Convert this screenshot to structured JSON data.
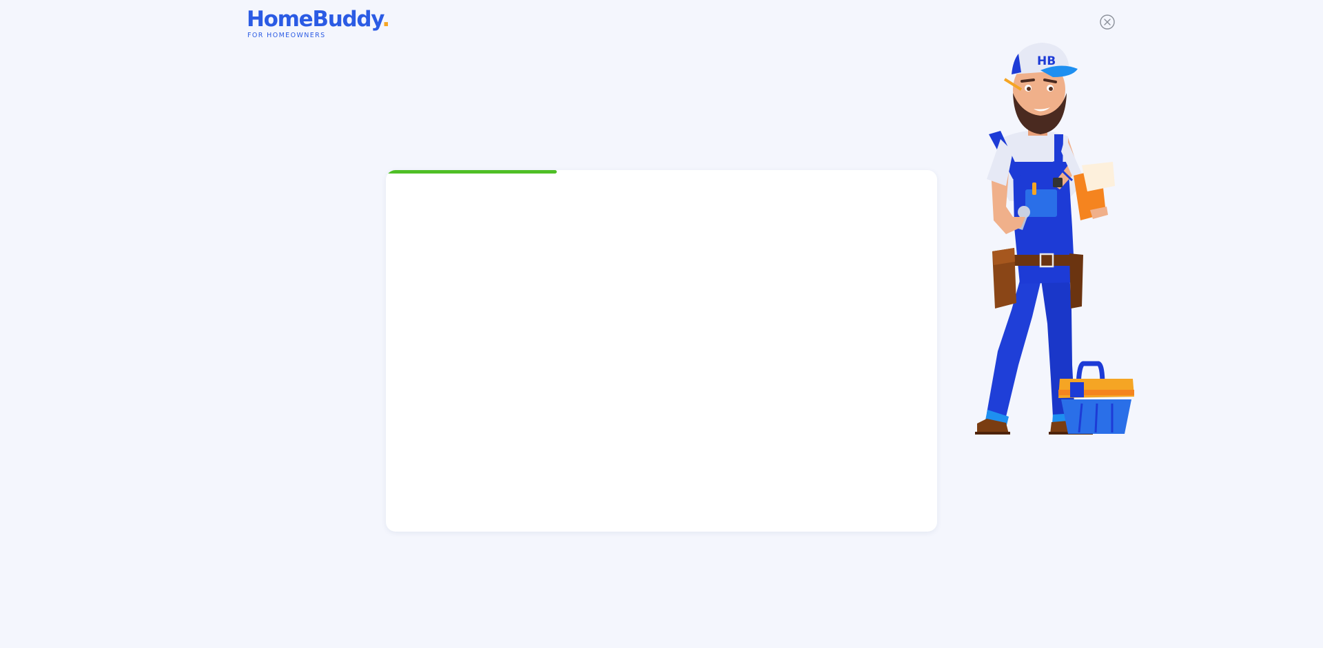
{
  "brand": {
    "name": "HomeBuddy",
    "dot": ".",
    "tagline": "FOR HOMEOWNERS",
    "primary_color": "#2b5be4",
    "accent_color": "#f5a524"
  },
  "header": {
    "close_icon": "close-circle-icon"
  },
  "form": {
    "progress_fraction": 0.31,
    "progress_color": "#4fbf26"
  },
  "illustration": {
    "cap_text": "HB"
  }
}
